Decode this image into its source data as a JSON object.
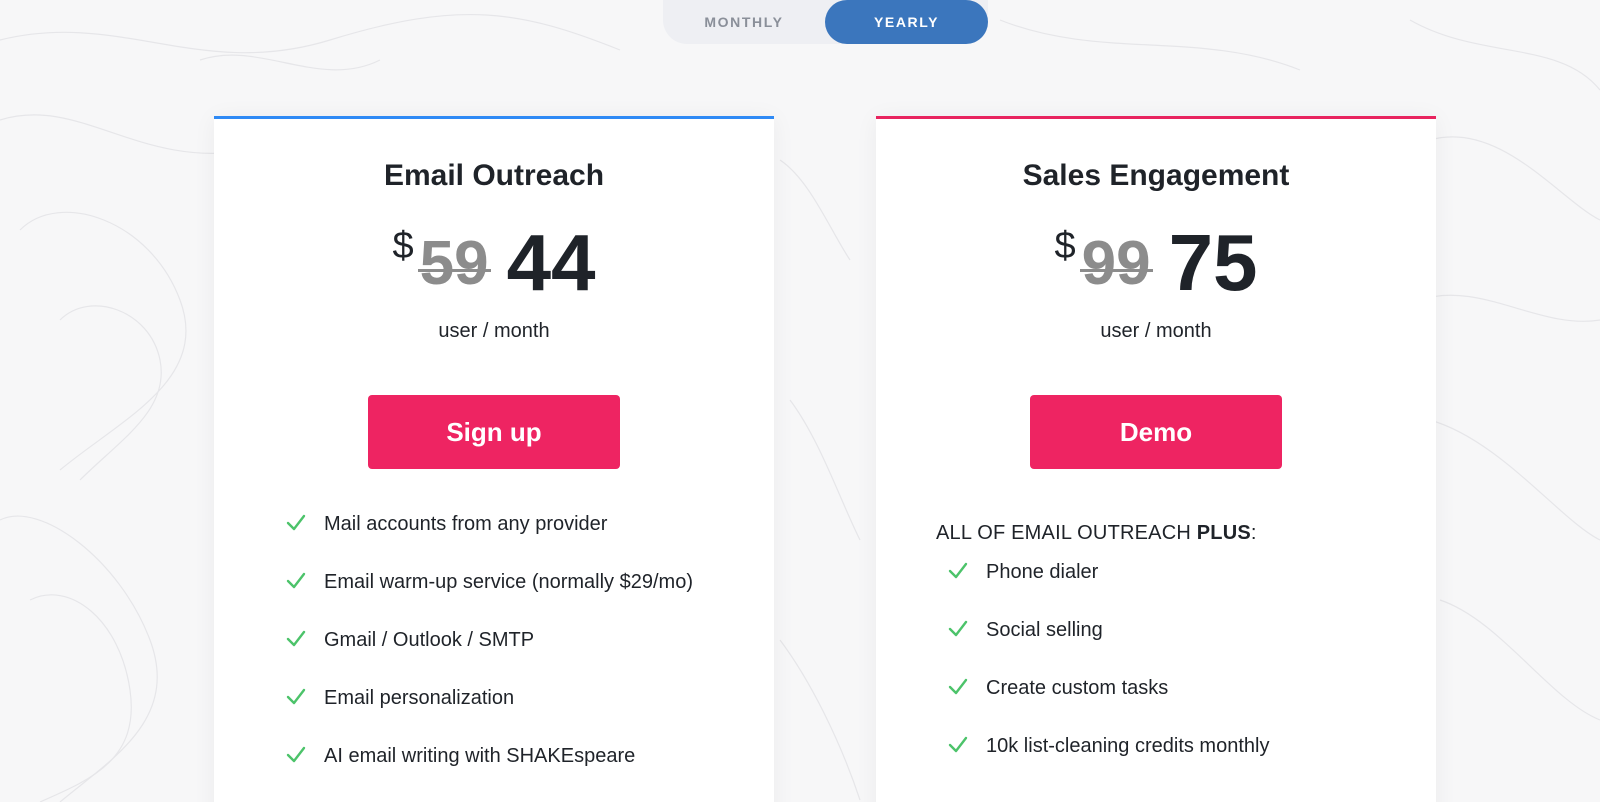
{
  "toggle": {
    "monthly_label": "MONTHLY",
    "yearly_label": "YEARLY",
    "selected": "yearly"
  },
  "plans": [
    {
      "title": "Email Outreach",
      "currency": "$",
      "old_price": "59",
      "new_price": "44",
      "unit": "user / month",
      "cta": "Sign up",
      "accent": "#2f8af5",
      "features": [
        "Mail accounts from any provider",
        "Email warm-up service (normally $29/mo)",
        "Gmail / Outlook / SMTP",
        "Email personalization",
        "AI email writing with SHAKEspeare"
      ]
    },
    {
      "title": "Sales Engagement",
      "currency": "$",
      "old_price": "99",
      "new_price": "75",
      "unit": "user / month",
      "cta": "Demo",
      "accent": "#e8245f",
      "intro_prefix": "ALL OF EMAIL OUTREACH ",
      "intro_bold": "PLUS",
      "intro_suffix": ":",
      "features": [
        "Phone dialer",
        "Social selling",
        "Create custom tasks",
        "10k list-cleaning credits monthly"
      ]
    }
  ],
  "colors": {
    "cta_background": "#ee2462",
    "toggle_active": "#3b76bd",
    "check_color": "#4cc36a"
  }
}
